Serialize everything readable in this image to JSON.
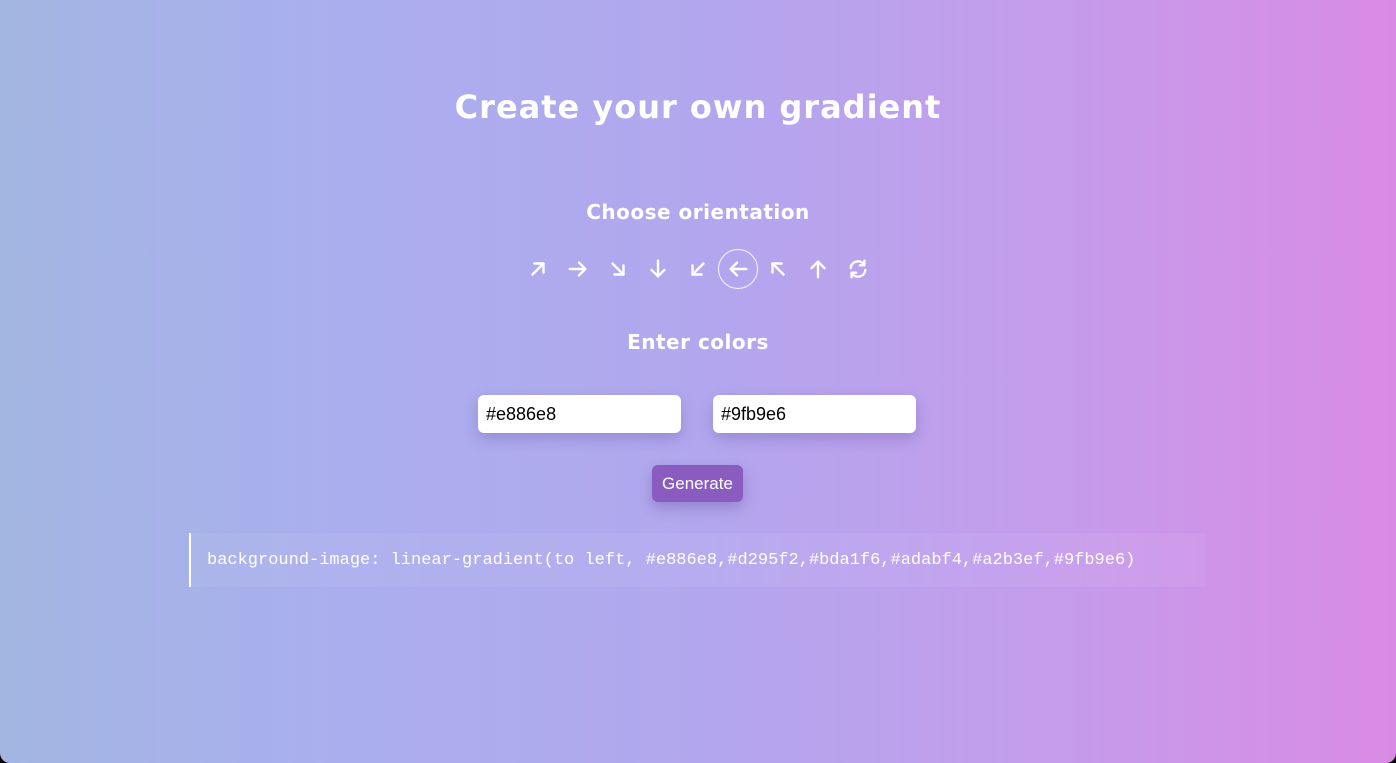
{
  "header": {
    "title": "Create your own gradient"
  },
  "orientation": {
    "heading": "Choose orientation",
    "options": [
      {
        "icon": "arrow-up-right-icon",
        "value": "to top right",
        "active": false
      },
      {
        "icon": "arrow-right-icon",
        "value": "to right",
        "active": false
      },
      {
        "icon": "arrow-down-right-icon",
        "value": "to bottom right",
        "active": false
      },
      {
        "icon": "arrow-down-icon",
        "value": "to bottom",
        "active": false
      },
      {
        "icon": "arrow-down-left-icon",
        "value": "to bottom left",
        "active": false
      },
      {
        "icon": "arrow-left-icon",
        "value": "to left",
        "active": true
      },
      {
        "icon": "arrow-up-left-icon",
        "value": "to top left",
        "active": false
      },
      {
        "icon": "arrow-up-icon",
        "value": "to top",
        "active": false
      },
      {
        "icon": "refresh-icon",
        "value": "radial",
        "active": false
      }
    ]
  },
  "colors": {
    "heading": "Enter colors",
    "color1": "#e886e8",
    "color2": "#9fb9e6"
  },
  "actions": {
    "generate_label": "Generate"
  },
  "output": {
    "css_code": "background-image: linear-gradient(to left, #e886e8,#d295f2,#bda1f6,#adabf4,#a2b3ef,#9fb9e6)"
  },
  "theme": {
    "text_color": "#ffffff",
    "button_color": "#8a5cc0"
  }
}
